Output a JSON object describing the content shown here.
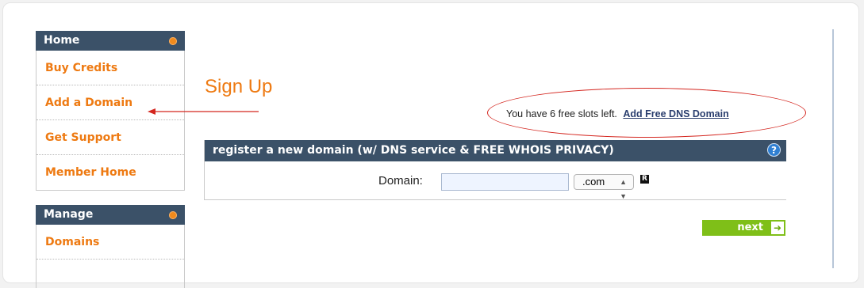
{
  "sidebar": {
    "home": {
      "title": "Home",
      "items": [
        "Buy Credits",
        "Add a Domain",
        "Get Support",
        "Member Home"
      ]
    },
    "manage": {
      "title": "Manage",
      "items": [
        "Domains"
      ]
    }
  },
  "main": {
    "title": "Sign Up",
    "slots_text": "You have 6 free slots left.",
    "add_dns_link": "Add Free DNS Domain",
    "box_title": "register a new domain (w/ DNS service & FREE WHOIS PRIVACY)",
    "help_icon": "?",
    "domain_label": "Domain:",
    "domain_value": "",
    "tld_selected": ".com",
    "r_badge": "R",
    "next_label": "next"
  },
  "colors": {
    "accent": "#ee7a12",
    "header": "#3b5168",
    "annotation": "#d4261f",
    "next": "#7fbf18"
  }
}
